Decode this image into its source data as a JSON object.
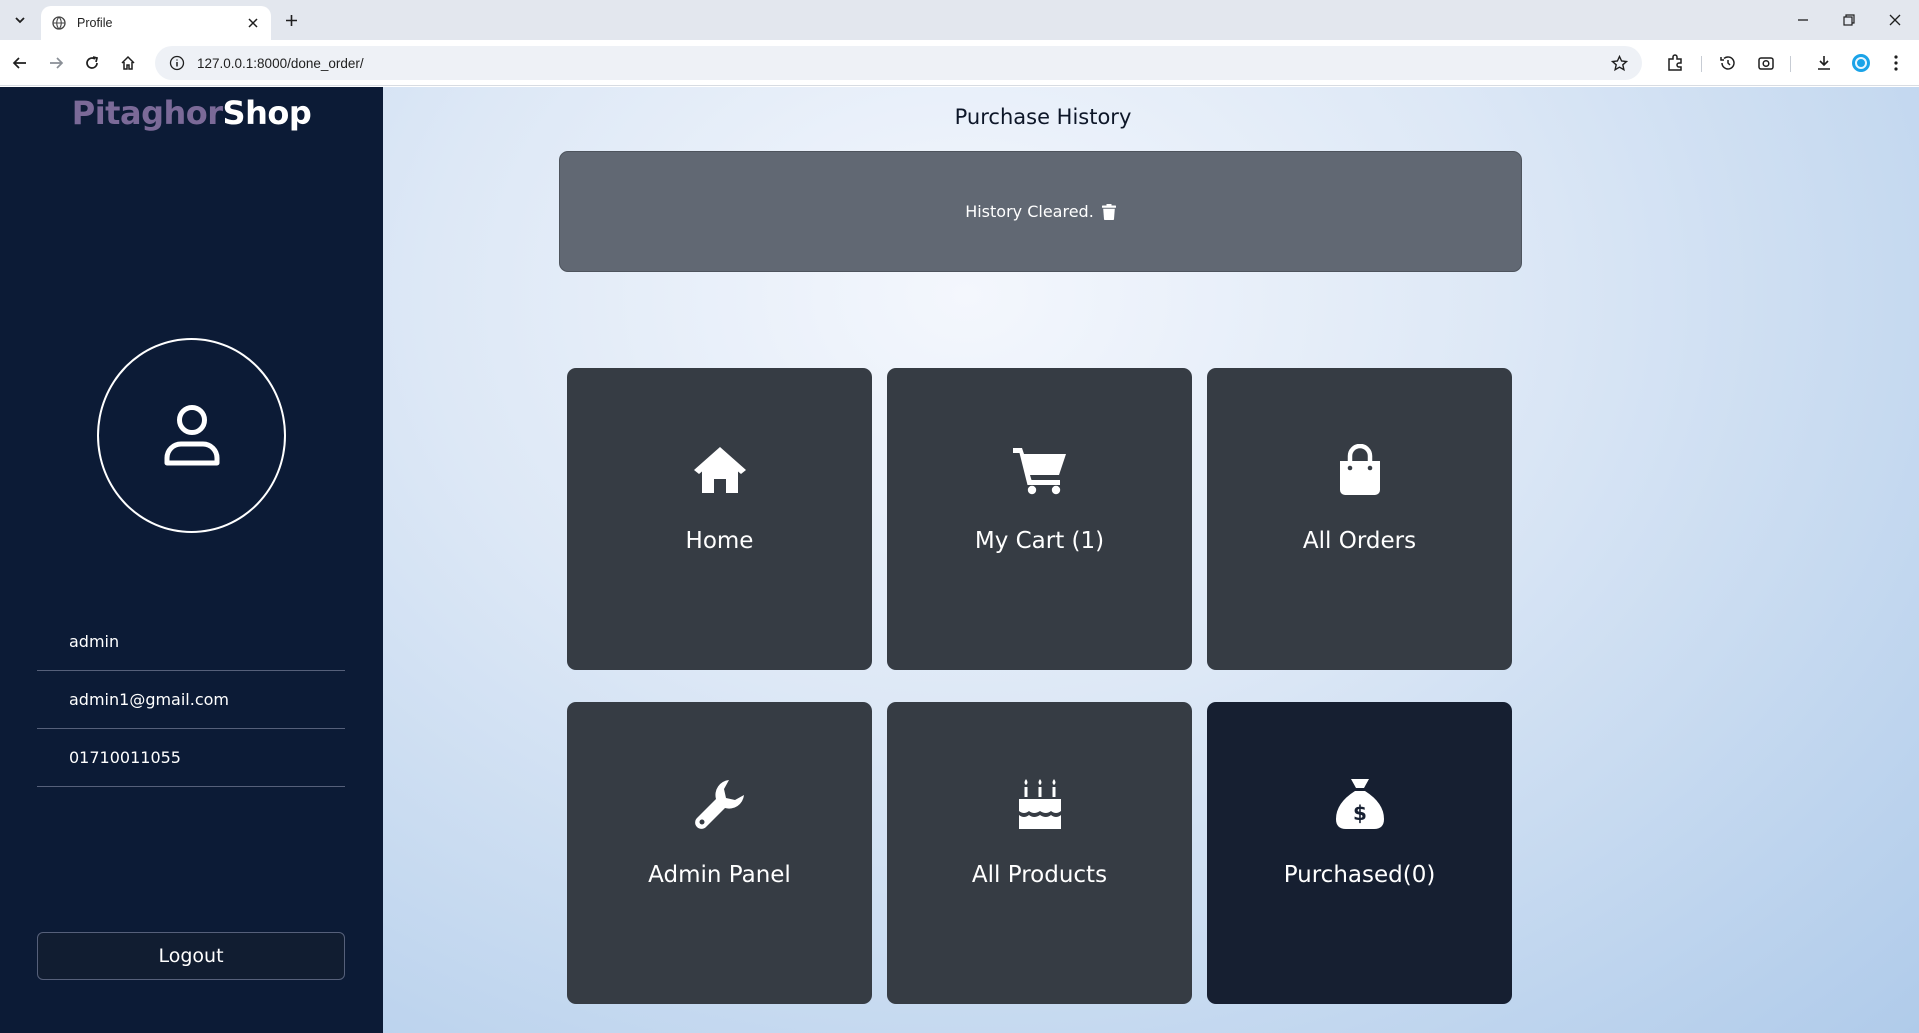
{
  "browser": {
    "tab_title": "Profile",
    "url": "127.0.0.1:8000/done_order/"
  },
  "sidebar": {
    "brand_part1": "Pitaghor",
    "brand_part2": "Shop",
    "username": "admin",
    "email": "admin1@gmail.com",
    "phone": "01710011055",
    "logout_label": "Logout"
  },
  "main": {
    "title": "Purchase History",
    "alert_text": "History Cleared.",
    "cards": [
      {
        "label": "Home",
        "icon": "home-icon"
      },
      {
        "label": "My Cart (1)",
        "icon": "cart-icon"
      },
      {
        "label": "All Orders",
        "icon": "shopping-bag-icon"
      },
      {
        "label": "Admin Panel",
        "icon": "wrench-icon"
      },
      {
        "label": "All Products",
        "icon": "cake-icon"
      },
      {
        "label": "Purchased(0)",
        "icon": "money-bag-icon"
      }
    ]
  },
  "colors": {
    "sidebar_bg": "#0c1b36",
    "card_bg": "#363c44",
    "card_active_bg": "#161f31",
    "alert_bg": "#616873",
    "brand_accent": "#7b6a98"
  }
}
